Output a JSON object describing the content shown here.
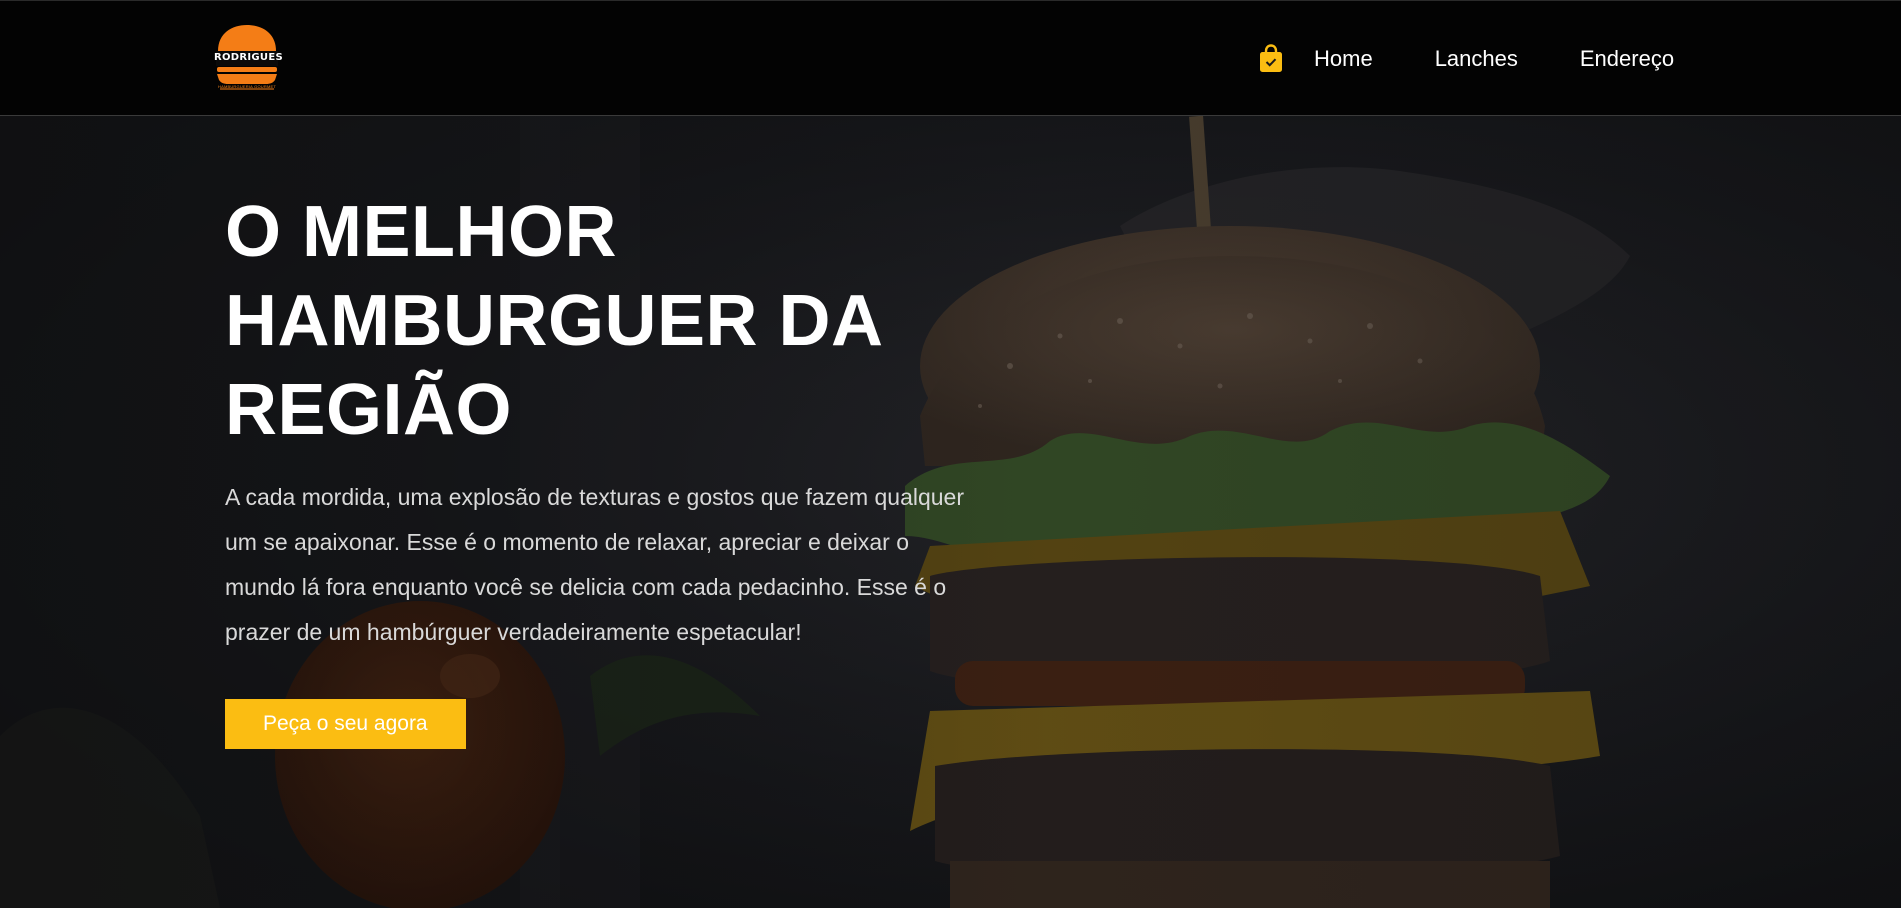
{
  "header": {
    "logo": {
      "brand": "RODRIGUES",
      "tagline": "HAMBURGUERIA GOURMET",
      "colors": {
        "bun": "#f47d16",
        "text": "#ffffff"
      }
    },
    "cart_icon": "shopping-bag-check-icon",
    "nav": [
      {
        "label": "Home"
      },
      {
        "label": "Lanches"
      },
      {
        "label": "Endereço"
      }
    ]
  },
  "hero": {
    "title": "O MELHOR HAMBURGUER DA REGIÃO",
    "description": "A cada mordida, uma explosão de texturas e gostos que fazem qualquer um se apaixonar. Esse é o momento de relaxar, apreciar e deixar o mundo lá fora enquanto você se delicia com cada pedacinho. Esse é o prazer de um hambúrguer verdadeiramente espetacular!",
    "cta_label": "Peça o seu agora",
    "background_image": "dark burger photo"
  },
  "colors": {
    "accent": "#fbbd12",
    "header_bg": "#030303",
    "hero_overlay": "#0b0b0c"
  }
}
